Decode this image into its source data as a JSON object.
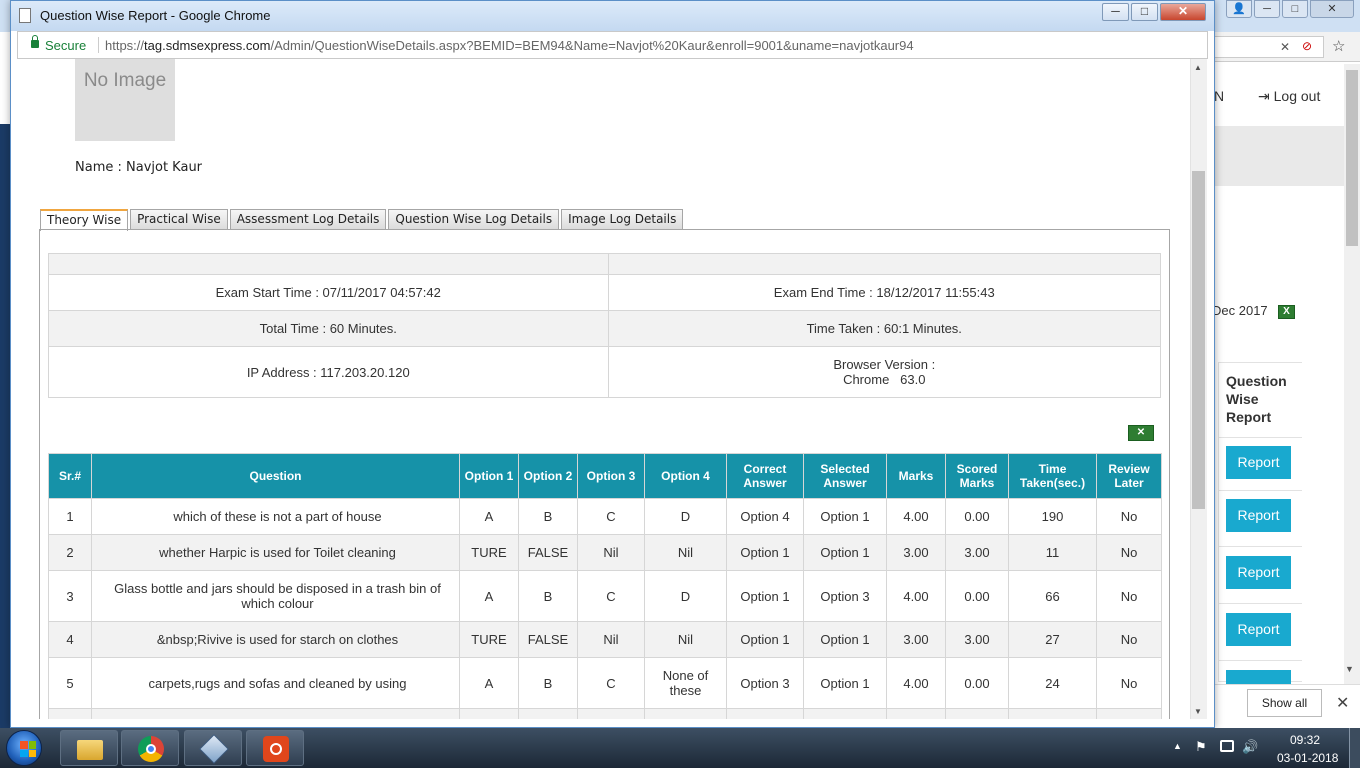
{
  "window": {
    "title": "Question Wise Report - Google Chrome",
    "controls": {
      "minimize": "─",
      "maximize": "□",
      "close": "✕"
    }
  },
  "address": {
    "secure_label": "Secure",
    "url_scheme": "https://",
    "url_host": "tag.sdmsexpress.com",
    "url_path": "/Admin/QuestionWiseDetails.aspx?BEMID=BEM94&Name=Navjot%20Kaur&enroll=9001&uname=navjotkaur94"
  },
  "profile": {
    "image_placeholder": "No Image",
    "name": "Name : Navjot Kaur"
  },
  "tabs": [
    "Theory Wise",
    "Practical Wise",
    "Assessment Log Details",
    "Question Wise Log Details",
    "Image Log Details"
  ],
  "info": {
    "exam_start": "Exam Start Time : 07/11/2017 04:57:42",
    "exam_end": "Exam End Time : 18/12/2017 11:55:43",
    "total_time": "Total Time : 60 Minutes.",
    "time_taken": "Time Taken : 60:1 Minutes.",
    "ip": "IP Address : 117.203.20.120",
    "browser_label": "Browser Version :",
    "browser_value": "Chrome   63.0"
  },
  "table": {
    "headers": [
      "Sr.#",
      "Question",
      "Option 1",
      "Option 2",
      "Option 3",
      "Option 4",
      "Correct Answer",
      "Selected Answer",
      "Marks",
      "Scored Marks",
      "Time Taken(sec.)",
      "Review Later"
    ],
    "rows": [
      [
        "1",
        "which of these is not a part of house",
        "A",
        "B",
        "C",
        "D",
        "Option 4",
        "Option 1",
        "4.00",
        "0.00",
        "190",
        "No"
      ],
      [
        "2",
        "whether Harpic is used for Toilet cleaning",
        "TURE",
        "FALSE",
        "Nil",
        "Nil",
        "Option 1",
        "Option 1",
        "3.00",
        "3.00",
        "11",
        "No"
      ],
      [
        "3",
        "Glass bottle and jars should be disposed in a trash bin of which colour",
        "A",
        "B",
        "C",
        "D",
        "Option 1",
        "Option 3",
        "4.00",
        "0.00",
        "66",
        "No"
      ],
      [
        "4",
        "&nbsp;Rivive is used for starch on clothes",
        "TURE",
        "FALSE",
        "Nil",
        "Nil",
        "Option 1",
        "Option 1",
        "3.00",
        "3.00",
        "27",
        "No"
      ],
      [
        "5",
        "carpets,rugs and sofas and cleaned by using",
        "A",
        "B",
        "C",
        "None of these",
        "Option 3",
        "Option 1",
        "4.00",
        "0.00",
        "24",
        "No"
      ]
    ]
  },
  "background_page": {
    "header_partial": "N",
    "logout": "Log out",
    "date_partial": "Dec 2017",
    "column_header": "Question Wise Report",
    "report_buttons": [
      "Report",
      "Report",
      "Report",
      "Report"
    ],
    "show_all": "Show all"
  },
  "taskbar": {
    "time": "09:32",
    "date": "03-01-2018"
  },
  "colors": {
    "table_header": "#1692a8",
    "report_button": "#19a9cf",
    "secure_green": "#188038"
  }
}
